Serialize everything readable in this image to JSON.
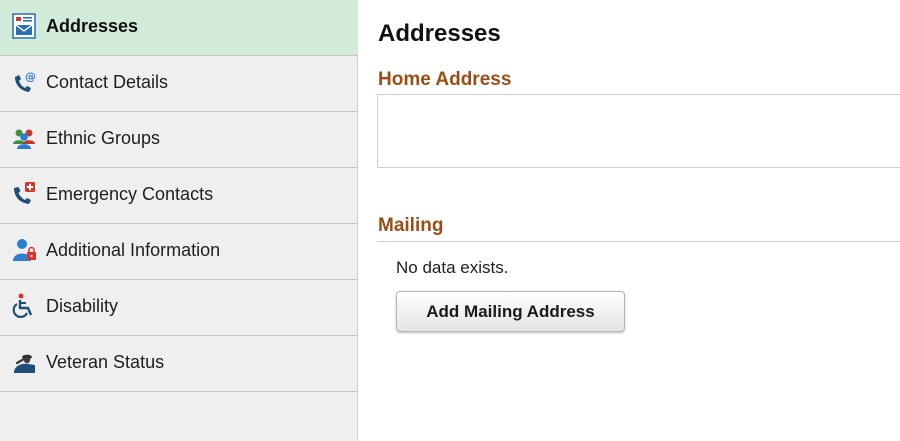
{
  "sidebar": {
    "items": [
      {
        "label": "Addresses",
        "icon": "address-card-icon",
        "active": true
      },
      {
        "label": "Contact Details",
        "icon": "phone-at-icon",
        "active": false
      },
      {
        "label": "Ethnic Groups",
        "icon": "people-group-icon",
        "active": false
      },
      {
        "label": "Emergency Contacts",
        "icon": "phone-medical-icon",
        "active": false
      },
      {
        "label": "Additional Information",
        "icon": "person-lock-icon",
        "active": false
      },
      {
        "label": "Disability",
        "icon": "wheelchair-icon",
        "active": false
      },
      {
        "label": "Veteran Status",
        "icon": "veteran-salute-icon",
        "active": false
      }
    ]
  },
  "main": {
    "title": "Addresses",
    "home_section": {
      "title": "Home Address"
    },
    "mailing_section": {
      "title": "Mailing",
      "empty_text": "No data exists.",
      "add_button_label": "Add Mailing Address"
    }
  },
  "colors": {
    "active_item_bg": "#d2ecd9",
    "section_title": "#9b4f16",
    "sidebar_bg": "#efefef"
  }
}
